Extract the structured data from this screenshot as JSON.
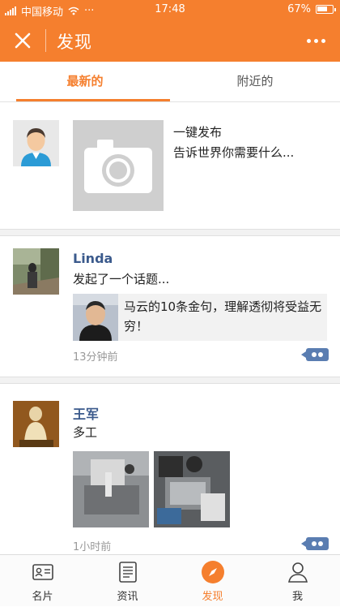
{
  "status_bar": {
    "carrier": "中国移动",
    "more": "···",
    "time": "17:48",
    "battery_text": "67%",
    "battery_level": 0.67
  },
  "header": {
    "title": "发现",
    "close_icon": "close-icon",
    "more_icon": "more-dots-icon"
  },
  "tabs": [
    {
      "label": "最新的",
      "active": true
    },
    {
      "label": "附近的",
      "active": false
    }
  ],
  "publish": {
    "line1": "一键发布",
    "line2": "告诉世界你需要什么..."
  },
  "posts": [
    {
      "name": "Linda",
      "text": "发起了一个话题...",
      "shared_title": "马云的10条金句，理解透彻将受益无穷！",
      "time": "13分钟前"
    },
    {
      "name": "王军",
      "text": "多工",
      "time": "1小时前"
    }
  ],
  "bottom_nav": [
    {
      "label": "名片",
      "icon": "card-icon",
      "active": false
    },
    {
      "label": "资讯",
      "icon": "news-icon",
      "active": false
    },
    {
      "label": "发现",
      "icon": "compass-icon",
      "active": true
    },
    {
      "label": "我",
      "icon": "person-icon",
      "active": false
    }
  ],
  "colors": {
    "accent": "#f57f2e",
    "name_blue": "#3b5a8c",
    "comment_blue": "#5a7db1"
  }
}
